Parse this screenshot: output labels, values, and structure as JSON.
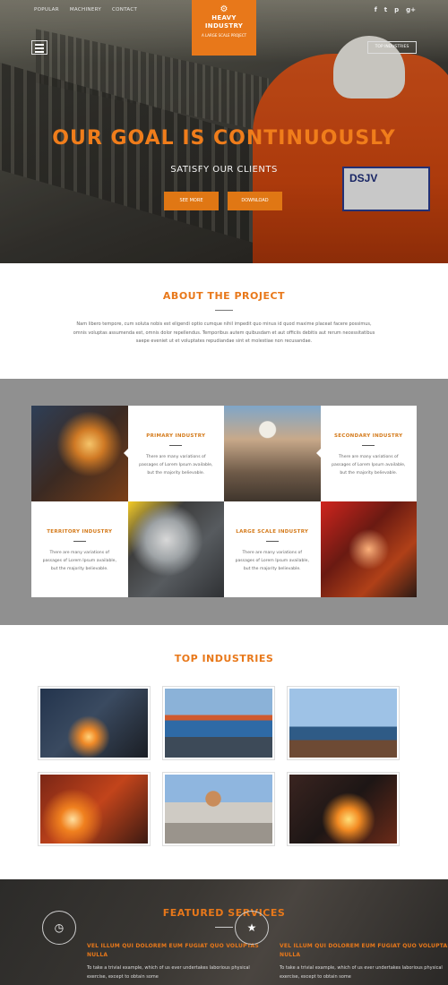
{
  "header": {
    "nav": [
      "POPULAR",
      "MACHINERY",
      "CONTACT"
    ],
    "social": [
      "f",
      "t",
      "p",
      "g+"
    ],
    "logo_name_1": "HEAVY",
    "logo_name_2": "INDUSTRY",
    "logo_tagline": "A LARGE SCALE PROJECT",
    "top_button": "TOP INDUSTRIES"
  },
  "hero": {
    "title": "OUR GOAL IS CONTINUOUSLY",
    "subtitle": "SATISFY OUR CLIENTS",
    "btn_see_more": "SEE MORE",
    "btn_download": "DOWNLOAD",
    "vest_text": "DSJV"
  },
  "about": {
    "title": "ABOUT THE PROJECT",
    "text": "Nam libero tempore, cum soluta nobis est eligendi optio cumque nihil impedit quo minus id quod maxime placeat facere possimus, omnis voluptas assumenda est, omnis dolor repellendus. Temporibus autem quibusdam et aut officiis debitis aut rerum necessitatibus saepe eveniet ut et voluptates repudiandae sint et molestiae non recusandae."
  },
  "industries": [
    {
      "title": "PRIMARY INDUSTRY",
      "text": "There are many variations of passages of Lorem Ipsum available, but the majority believable."
    },
    {
      "title": "SECONDARY INDUSTRY",
      "text": "There are many variations of passages of Lorem Ipsum available, but the majority believable."
    },
    {
      "title": "TERRITORY INDUSTRY",
      "text": "There are many variations of passages of Lorem Ipsum available, but the majority believable."
    },
    {
      "title": "LARGE SCALE INDUSTRY",
      "text": "There are many variations of passages of Lorem Ipsum available, but the majority believable."
    }
  ],
  "top_industries": {
    "title": "TOP INDUSTRIES"
  },
  "featured": {
    "title": "FEATURED SERVICES",
    "items": [
      {
        "icon": "clock-icon",
        "glyph": "◷",
        "title": "VEL ILLUM QUI DOLOREM EUM FUGIAT QUO VOLUPTAS NULLA",
        "text": "To take a trivial example, which of us ever undertakes laborious physical exercise, except to obtain some"
      },
      {
        "icon": "star-icon",
        "glyph": "★",
        "title": "VEL ILLUM QUI DOLOREM EUM FUGIAT QUO VOLUPTAS NULLA",
        "text": "To take a trivial example, which of us ever undertakes laborious physical exercise, except to obtain some"
      }
    ]
  },
  "colors": {
    "accent": "#e8781a",
    "grid_bg": "#909090",
    "footer_bg": "#2c2b29"
  }
}
